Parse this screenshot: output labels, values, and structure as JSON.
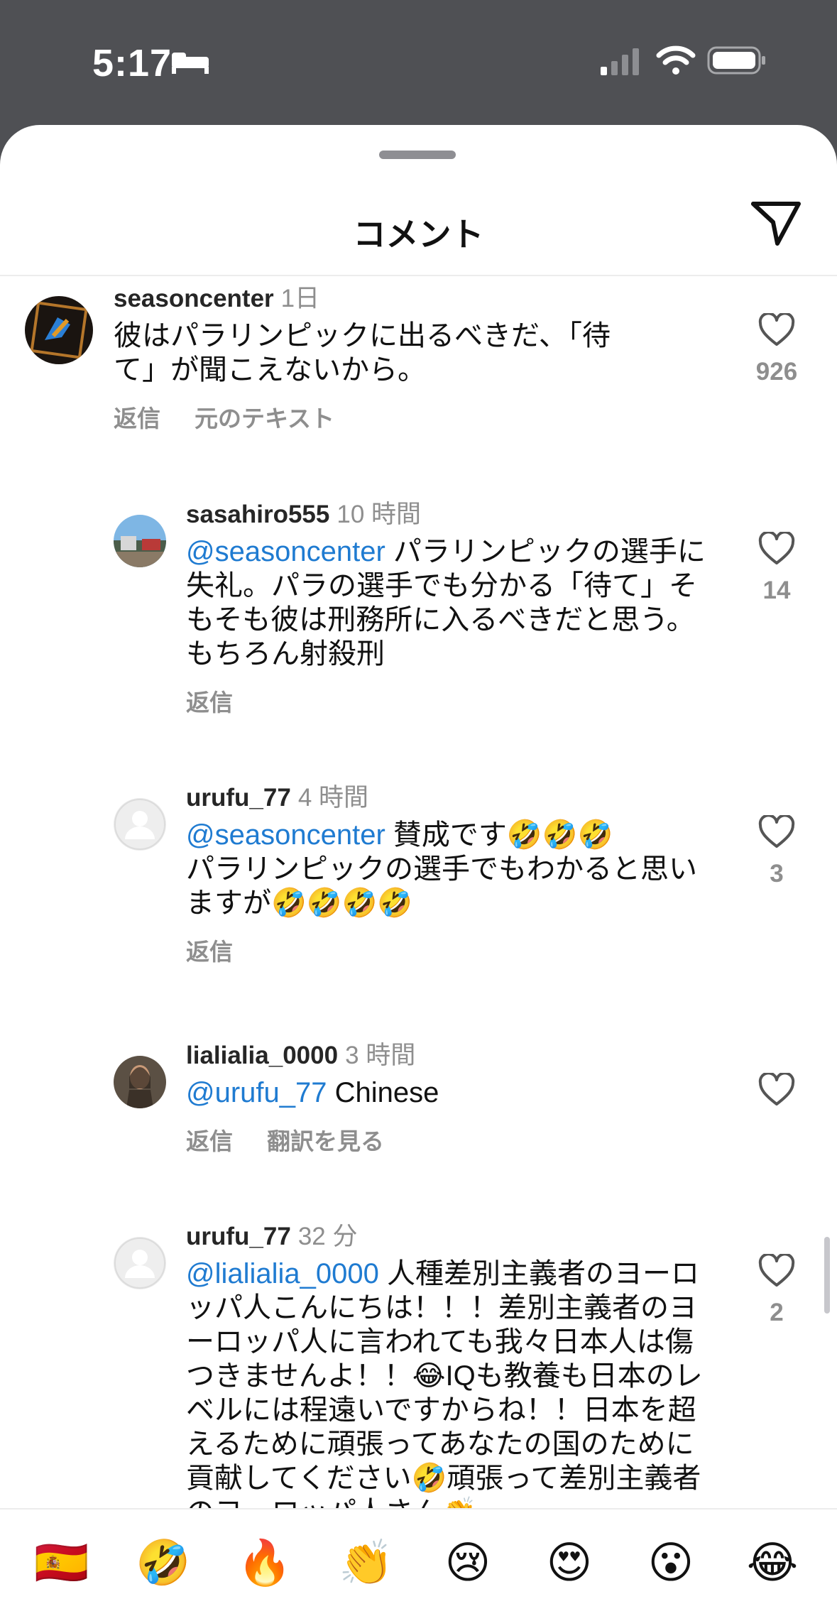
{
  "status_bar": {
    "time": "5:17",
    "icons": [
      "sleep-icon",
      "cellular-signal-icon",
      "wifi-icon",
      "battery-icon"
    ]
  },
  "sheet": {
    "title": "コメント",
    "share_icon": "send-icon"
  },
  "comments": [
    {
      "username": "seasoncenter",
      "time": "1日",
      "text": "彼はパラリンピックに出るべきだ､「待て」が聞こえないから。",
      "likes": "926",
      "actions": [
        "返信",
        "元のテキスト"
      ]
    },
    {
      "username": "sasahiro555",
      "time": "10 時間",
      "mention": "@seasoncenter",
      "text": "パラリンピックの選手に失礼。パラの選手でも分かる「待て」そもそも彼は刑務所に入るべきだと思う。もちろん射殺刑",
      "likes": "14",
      "actions": [
        "返信"
      ]
    },
    {
      "username": "urufu_77",
      "time": "4 時間",
      "mention": "@seasoncenter",
      "text_line1": "賛成です🤣🤣🤣",
      "text_line2": "パラリンピックの選手でもわかると思いますが🤣🤣🤣🤣",
      "likes": "3",
      "actions": [
        "返信"
      ]
    },
    {
      "username": "lialialia_0000",
      "time": "3 時間",
      "mention": "@urufu_77",
      "text": "Chinese",
      "likes": "",
      "actions": [
        "返信",
        "翻訳を見る"
      ]
    },
    {
      "username": "urufu_77",
      "time": "32 分",
      "mention": "@lialialia_0000",
      "text": "人種差別主義者のヨーロッパ人こんにちは！！！差別主義者のヨーロッパ人に言われても我々日本人は傷つきませんよ！！😂IQも教養も日本のレベルには程遠いですからね！！日本を超えるために頑張ってあなたの国のために貢献してください🤣頑張って差別主義者のヨーロッパ人さん👏",
      "likes": "2",
      "actions": []
    }
  ],
  "emoji_bar": [
    "🇪🇸",
    "🤣",
    "🔥",
    "👏",
    "😢",
    "😍",
    "😮",
    "😂"
  ],
  "colors": {
    "mention": "#1f7bd1",
    "status_bar_bg": "#4f5054",
    "muted": "#8e8e8e"
  }
}
